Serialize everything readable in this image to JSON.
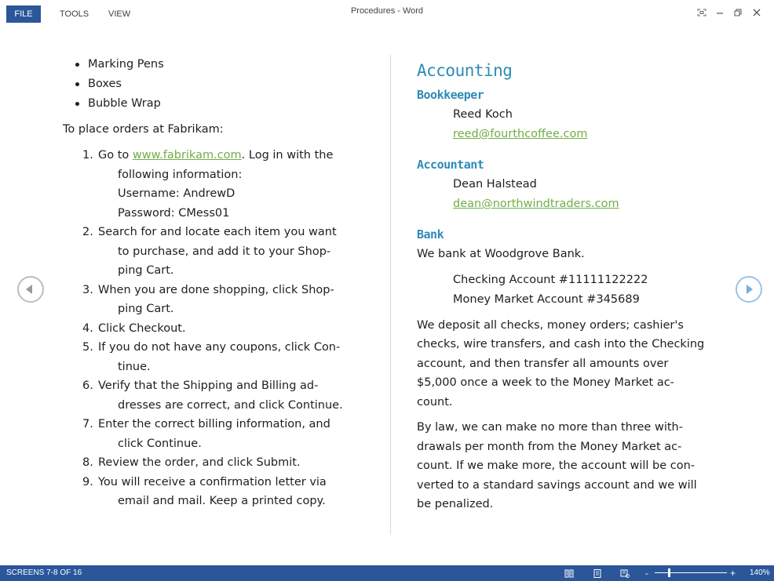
{
  "titlebar": {
    "file_tab": "FILE",
    "tools_tab": "TOOLS",
    "view_tab": "VIEW",
    "document_title": "Procedures - Word"
  },
  "left_column": {
    "bullets": [
      "Marking Pens",
      "Boxes",
      "Bubble Wrap"
    ],
    "intro": "To place orders at Fabrikam:",
    "steps": [
      {
        "num": "1.",
        "lines": [
          "Go to ",
          "www.fabrikam.com",
          ". Log in with the"
        ],
        "continuation": [
          "following information:",
          "Username: AndrewD",
          "Password: CMess01"
        ]
      },
      {
        "num": "2.",
        "first": "Search for and locate each item you want",
        "continuation": [
          "to purchase, and add it to your Shop-",
          "ping Cart."
        ]
      },
      {
        "num": "3.",
        "first": "When you are done shopping, click Shop-",
        "continuation": [
          "ping Cart."
        ]
      },
      {
        "num": "4.",
        "first": "Click Checkout.",
        "continuation": []
      },
      {
        "num": "5.",
        "first": "If you do not have any coupons, click Con-",
        "continuation": [
          "tinue."
        ]
      },
      {
        "num": "6.",
        "first": "Verify that the Shipping and Billing ad-",
        "continuation": [
          "dresses are correct, and click Continue."
        ]
      },
      {
        "num": "7.",
        "first": "Enter the correct billing information, and",
        "continuation": [
          "click Continue."
        ]
      },
      {
        "num": "8.",
        "first": "Review the order, and click Submit.",
        "continuation": []
      },
      {
        "num": "9.",
        "first": "You will receive a confirmation letter via",
        "continuation": [
          "email and mail. Keep a printed copy."
        ]
      }
    ]
  },
  "right_column": {
    "heading": "Accounting",
    "bookkeeper": {
      "label": "Bookkeeper",
      "name": "Reed Koch",
      "email": "reed@fourthcoffee.com"
    },
    "accountant": {
      "label": "Accountant",
      "name": "Dean Halstead",
      "email": "dean@northwindtraders.com"
    },
    "bank": {
      "label": "Bank",
      "intro": "We bank at Woodgrove Bank.",
      "checking": "Checking Account #11111122222",
      "money_market": "Money Market Account #345689",
      "para1": [
        "We deposit all checks, money orders; cashier's",
        "checks, wire transfers, and cash into the Checking",
        "account, and then transfer all amounts over",
        "$5,000 once a week to the Money Market ac-",
        "count."
      ],
      "para2": [
        "By law, we can make no more than three with-",
        "drawals per month from the Money Market ac-",
        "count. If we make more, the account will be con-",
        "verted to a standard savings account and we will",
        "be penalized."
      ]
    }
  },
  "statusbar": {
    "screens": "SCREENS 7-8 OF 16",
    "zoom_minus": "-",
    "zoom_plus": "+",
    "zoom_level": "140%"
  },
  "colors": {
    "accent_blue": "#2b579a",
    "heading_blue": "#2e8bb5",
    "link_green": "#70ad47"
  },
  "icons": {
    "nav_prev": "left-arrow-circle-icon",
    "nav_next": "right-arrow-circle-icon"
  }
}
